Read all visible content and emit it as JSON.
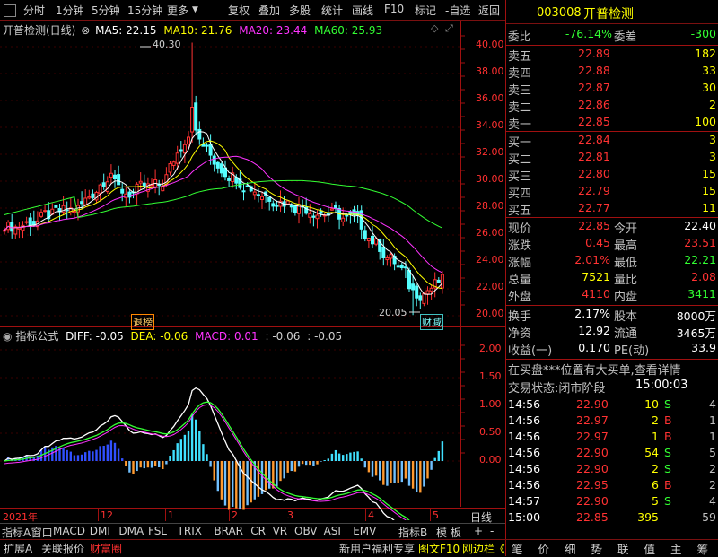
{
  "toolbar": {
    "left": [
      "分时",
      "1分钟",
      "5分钟",
      "15分钟",
      "更多"
    ],
    "right": [
      "复权",
      "叠加",
      "多股",
      "统计",
      "画线",
      "F10",
      "标记",
      "-自选",
      "返回"
    ]
  },
  "chart": {
    "title": "开普检测(日线)",
    "ma": [
      {
        "label": "MA5: 22.15",
        "color": "#ffffff"
      },
      {
        "label": "MA10: 21.76",
        "color": "#ffff00"
      },
      {
        "label": "MA20: 23.44",
        "color": "#ff33ff"
      },
      {
        "label": "MA60: 25.93",
        "color": "#33ff33"
      }
    ],
    "high_label": "40.30",
    "low_label": "20.05",
    "tag1": "退榜",
    "tag2": "财减",
    "price_ticks": [
      "40.00",
      "38.00",
      "36.00",
      "34.00",
      "32.00",
      "30.00",
      "28.00",
      "26.00",
      "24.00",
      "22.00",
      "20.00"
    ],
    "macd_ticks": [
      "2.00",
      "1.50",
      "1.00",
      "0.50",
      "0.00"
    ],
    "date_labels": [
      "2021年",
      "12",
      "1",
      "2",
      "3",
      "4",
      "5"
    ],
    "indicator_header": {
      "title": "指标公式",
      "diff": "DIFF: -0.05",
      "dea": "DEA: -0.06",
      "macd": "MACD: 0.01",
      "v1": ": -0.06",
      "v2": ": -0.05"
    }
  },
  "indicator_tabs": [
    "指标A",
    "窗口",
    "MACD",
    "DMI",
    "DMA",
    "FSL",
    "TRIX",
    "BRAR",
    "CR",
    "VR",
    "OBV",
    "ASI",
    "EMV"
  ],
  "indicator_tabs_right": [
    "指标B",
    "模 板",
    "+",
    "-"
  ],
  "day_line": "日线",
  "bottom_left": [
    "扩展A",
    "关联报价",
    "财富圈"
  ],
  "bottom_mid": [
    "新用户福利专享",
    "图文F10",
    "刚边栏《"
  ],
  "quote": {
    "code": "003008",
    "name": "开普检测",
    "weibi": {
      "l": "委比",
      "v": "-76.14%",
      "l2": "委差",
      "v2": "-300"
    },
    "asks": [
      {
        "l": "卖五",
        "p": "22.89",
        "q": "182"
      },
      {
        "l": "卖四",
        "p": "22.88",
        "q": "33"
      },
      {
        "l": "卖三",
        "p": "22.87",
        "q": "30"
      },
      {
        "l": "卖二",
        "p": "22.86",
        "q": "2"
      },
      {
        "l": "卖一",
        "p": "22.85",
        "q": "100"
      }
    ],
    "bids": [
      {
        "l": "买一",
        "p": "22.84",
        "q": "3"
      },
      {
        "l": "买二",
        "p": "22.81",
        "q": "3"
      },
      {
        "l": "买三",
        "p": "22.80",
        "q": "15"
      },
      {
        "l": "买四",
        "p": "22.79",
        "q": "15"
      },
      {
        "l": "买五",
        "p": "22.77",
        "q": "11"
      }
    ],
    "stats": [
      {
        "l": "现价",
        "v": "22.85",
        "l2": "今开",
        "v2": "22.40",
        "c": "red",
        "c2": "wht"
      },
      {
        "l": "涨跌",
        "v": "0.45",
        "l2": "最高",
        "v2": "23.51",
        "c": "red",
        "c2": "red"
      },
      {
        "l": "涨幅",
        "v": "2.01%",
        "l2": "最低",
        "v2": "22.21",
        "c": "red",
        "c2": "grn"
      },
      {
        "l": "总量",
        "v": "7521",
        "l2": "量比",
        "v2": "2.08",
        "c": "yel",
        "c2": "red"
      },
      {
        "l": "外盘",
        "v": "4110",
        "l2": "内盘",
        "v2": "3411",
        "c": "red",
        "c2": "grn"
      }
    ],
    "stats2": [
      {
        "l": "换手",
        "v": "2.17%",
        "l2": "股本",
        "v2": "8000万"
      },
      {
        "l": "净资",
        "v": "12.92",
        "l2": "流通",
        "v2": "3465万"
      },
      {
        "l": "收益(一)",
        "v": "0.170",
        "l2": "PE(动)",
        "v2": "33.9"
      }
    ],
    "notice": "在买盘***位置有大买单,查看详情",
    "status_label": "交易状态:闭市阶段",
    "status_time": "15:00:03",
    "trades": [
      {
        "t": "14:56",
        "p": "22.90",
        "q": "10",
        "s": "S",
        "n": "4"
      },
      {
        "t": "14:56",
        "p": "22.97",
        "q": "2",
        "s": "B",
        "n": "1"
      },
      {
        "t": "14:56",
        "p": "22.97",
        "q": "1",
        "s": "B",
        "n": "1"
      },
      {
        "t": "14:56",
        "p": "22.90",
        "q": "54",
        "s": "S",
        "n": "5"
      },
      {
        "t": "14:56",
        "p": "22.90",
        "q": "2",
        "s": "S",
        "n": "2"
      },
      {
        "t": "14:56",
        "p": "22.95",
        "q": "6",
        "s": "B",
        "n": "2"
      },
      {
        "t": "14:57",
        "p": "22.90",
        "q": "5",
        "s": "S",
        "n": "4"
      },
      {
        "t": "15:00",
        "p": "22.85",
        "q": "395",
        "s": "",
        "n": "59"
      }
    ],
    "bottom_tabs": [
      "笔",
      "价",
      "细",
      "势",
      "联",
      "值",
      "主",
      "筹"
    ]
  }
}
